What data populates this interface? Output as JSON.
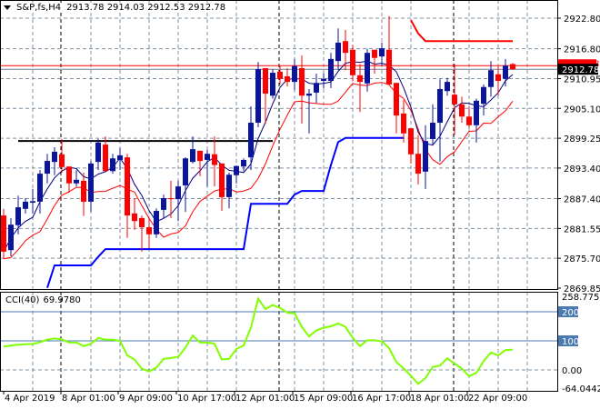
{
  "header": {
    "symbol": "S&P,fs,H4",
    "ohlc": "2913.78 2914.03 2912.53 2912.78"
  },
  "indicator": {
    "name": "CCI(40)",
    "value": "69.9780"
  },
  "colors": {
    "bull": "#0a149f",
    "bear": "#ff0000",
    "ma_fast": "#000080",
    "ma_slow": "#ff0000",
    "channel_low": "#0000ff",
    "channel_high": "#ff0000",
    "cci": "#7fff00",
    "level": "#4a7ab0"
  },
  "chart_data": [
    {
      "type": "candlestick",
      "title": "S&P,fs,H4",
      "ylim": [
        2869.85,
        2922.8
      ],
      "y_ticks": [
        "2922.80",
        "2916.80",
        "2910.95",
        "2905.10",
        "2899.25",
        "2893.40",
        "2887.40",
        "2881.55",
        "2875.70",
        "2869.85"
      ],
      "x_ticks": [
        "4 Apr 2019",
        "8 Apr 01:00",
        "9 Apr 09:00",
        "10 Apr 17:00",
        "12 Apr 01:00",
        "15 Apr 09:00",
        "16 Apr 17:00",
        "18 Apr 01:00",
        "22 Apr 09:00"
      ],
      "bid_label": "2912.78",
      "bid_price": 2912.78,
      "ask_label": "2913.48",
      "ask_price": 2913.48,
      "support_line": {
        "price": 2898.7,
        "from": 1,
        "to": 37
      },
      "candles_ohlc": [
        [
          2884.1,
          2885.4,
          2875.6,
          2877.0
        ],
        [
          2877.3,
          2883.6,
          2876.1,
          2882.3
        ],
        [
          2882.2,
          2888.0,
          2880.4,
          2885.7
        ],
        [
          2885.4,
          2887.5,
          2884.5,
          2886.8
        ],
        [
          2886.6,
          2889.3,
          2884.5,
          2886.9
        ],
        [
          2886.8,
          2893.0,
          2884.5,
          2892.3
        ],
        [
          2892.3,
          2896.2,
          2890.4,
          2894.8
        ],
        [
          2894.6,
          2897.5,
          2892.0,
          2896.6
        ],
        [
          2896.1,
          2899.1,
          2892.5,
          2893.6
        ],
        [
          2893.7,
          2893.7,
          2888.6,
          2890.4
        ],
        [
          2890.4,
          2893.0,
          2889.8,
          2891.1
        ],
        [
          2890.9,
          2892.5,
          2884.0,
          2886.8
        ],
        [
          2886.8,
          2894.8,
          2884.8,
          2894.3
        ],
        [
          2894.6,
          2899.1,
          2893.0,
          2898.4
        ],
        [
          2898.0,
          2899.6,
          2892.8,
          2892.8
        ],
        [
          2892.8,
          2896.2,
          2892.3,
          2895.3
        ],
        [
          2895.0,
          2897.3,
          2893.0,
          2895.9
        ],
        [
          2895.5,
          2896.2,
          2879.7,
          2884.1
        ],
        [
          2884.5,
          2887.5,
          2881.3,
          2883.0
        ],
        [
          2883.6,
          2884.1,
          2877.0,
          2881.8
        ],
        [
          2881.8,
          2883.6,
          2877.7,
          2880.4
        ],
        [
          2880.4,
          2885.5,
          2879.7,
          2885.0
        ],
        [
          2885.2,
          2888.2,
          2883.6,
          2887.5
        ],
        [
          2887.5,
          2890.9,
          2883.6,
          2887.3
        ],
        [
          2887.3,
          2890.9,
          2883.0,
          2889.8
        ],
        [
          2890.0,
          2895.5,
          2884.8,
          2895.3
        ],
        [
          2894.6,
          2899.6,
          2894.3,
          2897.1
        ],
        [
          2896.8,
          2896.8,
          2891.8,
          2894.8
        ],
        [
          2895.0,
          2897.0,
          2889.8,
          2896.2
        ],
        [
          2896.1,
          2899.6,
          2889.8,
          2894.0
        ],
        [
          2894.3,
          2894.3,
          2885.0,
          2887.7
        ],
        [
          2887.7,
          2892.5,
          2885.5,
          2892.1
        ],
        [
          2892.0,
          2893.9,
          2890.4,
          2893.8
        ],
        [
          2893.7,
          2895.3,
          2892.8,
          2895.0
        ],
        [
          2895.5,
          2905.5,
          2893.0,
          2902.3
        ],
        [
          2902.3,
          2914.2,
          2901.4,
          2912.8
        ],
        [
          2913.0,
          2913.0,
          2902.1,
          2908.0
        ],
        [
          2907.6,
          2912.8,
          2907.0,
          2912.1
        ],
        [
          2912.3,
          2913.4,
          2909.8,
          2910.9
        ],
        [
          2911.4,
          2913.0,
          2909.4,
          2910.3
        ],
        [
          2910.3,
          2914.8,
          2908.7,
          2913.4
        ],
        [
          2913.0,
          2915.5,
          2902.1,
          2907.6
        ],
        [
          2907.6,
          2908.9,
          2900.2,
          2908.0
        ],
        [
          2908.2,
          2911.9,
          2906.2,
          2910.1
        ],
        [
          2910.5,
          2912.0,
          2909.0,
          2910.9
        ],
        [
          2910.5,
          2916.0,
          2909.1,
          2914.8
        ],
        [
          2914.4,
          2920.8,
          2912.6,
          2918.0
        ],
        [
          2918.3,
          2920.5,
          2912.6,
          2916.0
        ],
        [
          2916.6,
          2917.5,
          2910.4,
          2911.6
        ],
        [
          2911.6,
          2913.8,
          2904.4,
          2910.3
        ],
        [
          2910.0,
          2916.8,
          2908.4,
          2916.0
        ],
        [
          2916.6,
          2916.6,
          2911.9,
          2915.0
        ],
        [
          2915.3,
          2918.0,
          2913.5,
          2916.9
        ],
        [
          2916.6,
          2923.2,
          2909.8,
          2909.8
        ],
        [
          2910.1,
          2910.1,
          2900.2,
          2903.7
        ],
        [
          2904.1,
          2906.7,
          2898.4,
          2900.2
        ],
        [
          2901.2,
          2901.2,
          2894.3,
          2896.1
        ],
        [
          2896.2,
          2899.9,
          2890.2,
          2892.3
        ],
        [
          2892.7,
          2901.8,
          2889.3,
          2898.7
        ],
        [
          2899.1,
          2905.9,
          2897.8,
          2902.3
        ],
        [
          2902.3,
          2910.8,
          2894.7,
          2908.9
        ],
        [
          2908.5,
          2911.1,
          2907.6,
          2910.3
        ],
        [
          2907.8,
          2913.8,
          2899.9,
          2905.9
        ],
        [
          2905.9,
          2907.4,
          2902.3,
          2903.5
        ],
        [
          2903.5,
          2905.5,
          2901.3,
          2901.8
        ],
        [
          2901.8,
          2907.0,
          2898.4,
          2906.6
        ],
        [
          2906.0,
          2909.8,
          2903.7,
          2909.3
        ],
        [
          2909.3,
          2914.4,
          2907.4,
          2912.6
        ],
        [
          2911.8,
          2913.3,
          2907.6,
          2910.5
        ],
        [
          2910.9,
          2914.8,
          2909.4,
          2913.5
        ],
        [
          2913.8,
          2914.0,
          2912.6,
          2912.8
        ]
      ],
      "channel_low": {
        "start": 6,
        "values": [
          2869.9,
          2874.3,
          2874.3,
          2874.3,
          2874.3,
          2874.3,
          2874.3,
          2876.0,
          2877.5,
          2877.5,
          2877.5,
          2877.5,
          2877.5,
          2877.5,
          2877.5,
          2877.5,
          2877.5,
          2877.5,
          2877.5,
          2877.5,
          2877.5,
          2877.5,
          2877.5,
          2877.5,
          2877.5,
          2877.5,
          2877.5,
          2877.5,
          2886.4,
          2886.4,
          2886.4,
          2886.4,
          2886.4,
          2886.4,
          2888.2,
          2888.9,
          2888.9,
          2888.9,
          2888.9,
          2894.0,
          2898.5,
          2899.3,
          2899.3,
          2899.3,
          2899.3,
          2899.3,
          2899.3,
          2899.3,
          2899.3,
          2899.3
        ]
      },
      "channel_high": {
        "start": 56,
        "values": [
          2922.4,
          2919.8,
          2918.3,
          2918.3,
          2918.3,
          2918.3,
          2918.3,
          2918.3,
          2918.3,
          2918.3,
          2918.3,
          2918.3,
          2918.3,
          2918.3,
          2918.3
        ]
      },
      "ma_fast_period": 5,
      "ma_slow_period": 6
    },
    {
      "type": "line",
      "title": "CCI(40)",
      "ylim": [
        -64.0442,
        258.7753
      ],
      "y_ticks": [
        "258.7753",
        "200",
        "100",
        "0.00",
        "-64.0442"
      ],
      "levels": [
        200,
        100
      ],
      "values": [
        80,
        84,
        87,
        88,
        89,
        95,
        104,
        108,
        105,
        94,
        94,
        82,
        90,
        110,
        104,
        104,
        100,
        50,
        36,
        4,
        -5,
        8,
        38,
        41,
        45,
        77,
        118,
        94,
        94,
        90,
        36,
        38,
        72,
        84,
        145,
        245,
        209,
        223,
        213,
        197,
        195,
        148,
        115,
        136,
        145,
        150,
        160,
        148,
        110,
        82,
        102,
        102,
        98,
        75,
        27,
        5,
        -20,
        -48,
        -28,
        10,
        15,
        40,
        22,
        5,
        -22,
        -10,
        30,
        60,
        50,
        68,
        70
      ]
    }
  ]
}
